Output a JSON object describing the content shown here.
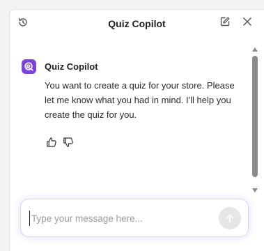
{
  "header": {
    "title": "Quiz Copilot",
    "left_icon": "history-icon",
    "right_icons": [
      "edit-icon",
      "close-icon"
    ]
  },
  "messages": [
    {
      "sender": "Quiz Copilot",
      "avatar_icon": "quiz-copilot-logo-icon",
      "text": "You want to create a quiz for your store. Please let me know what you had in mind. I'll help you create the quiz for you.",
      "actions": [
        "thumbs-up-icon",
        "thumbs-down-icon"
      ]
    }
  ],
  "composer": {
    "placeholder": "Type your message here...",
    "value": "",
    "send_icon": "arrow-up-icon"
  },
  "colors": {
    "accent": "#7b3fe4",
    "input_glow": "#d9d6f2",
    "send_button_disabled": "#e6e6e8"
  }
}
